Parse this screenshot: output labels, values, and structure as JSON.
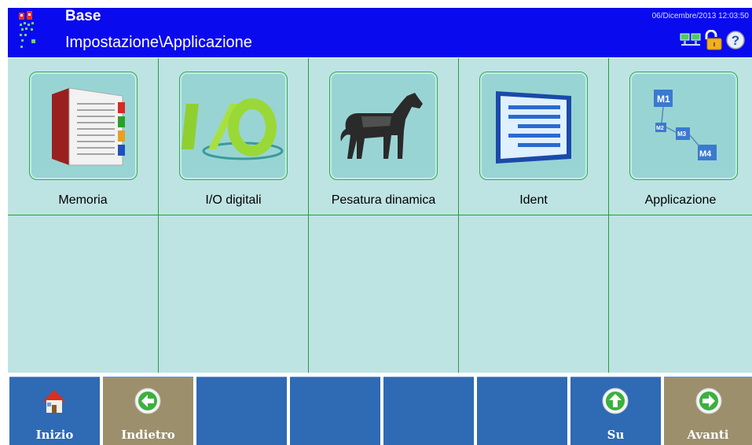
{
  "header": {
    "title": "Base",
    "path": "Impostazione\\Applicazione",
    "datetime": "06/Dicembre/2013 12:03:50",
    "icons": [
      "network-icon",
      "lock-icon",
      "help-icon"
    ]
  },
  "tiles": [
    {
      "label": "Memoria",
      "icon": "memory-book-icon"
    },
    {
      "label": "I/O digitali",
      "icon": "digital-io-icon"
    },
    {
      "label": "Pesatura dinamica",
      "icon": "horse-icon"
    },
    {
      "label": "Ident",
      "icon": "ident-window-icon"
    },
    {
      "label": "Applicazione",
      "icon": "application-m1-m4-icon"
    }
  ],
  "footer": {
    "home": "Inizio",
    "back": "Indietro",
    "up": "Su",
    "next": "Avanti"
  },
  "colors": {
    "header_bg": "#0a0aee",
    "grid_bg": "#bde4e3",
    "grid_line": "#2a9a3c",
    "button_blue": "#2f6ab5",
    "button_tan": "#9c8f6c"
  }
}
